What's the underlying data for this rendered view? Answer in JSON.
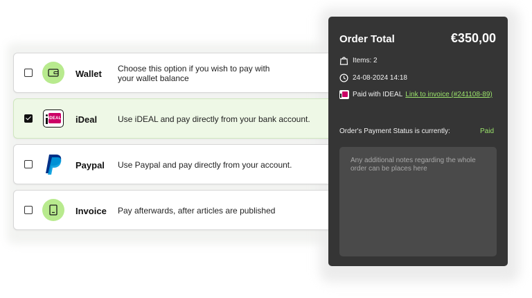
{
  "payment_methods": [
    {
      "name": "Wallet",
      "description": "Choose this option if you wish to pay with your wallet balance",
      "checked": false,
      "icon": "wallet-icon"
    },
    {
      "name": "iDeal",
      "description": "Use iDEAL and pay directly from your bank account.",
      "checked": true,
      "icon": "ideal-logo",
      "badge_text": "iDEAL"
    },
    {
      "name": "Paypal",
      "description": "Use Paypal and pay directly from your account.",
      "checked": false,
      "icon": "paypal-logo"
    },
    {
      "name": "Invoice",
      "description": "Pay afterwards, after articles are published",
      "checked": false,
      "icon": "invoice-icon"
    }
  ],
  "order": {
    "title": "Order Total",
    "amount": "€350,00",
    "items": "Items: 2",
    "datetime": "24-08-2024 14:18",
    "paid_with": "Paid with IDEAL",
    "invoice_link": "Link to invoice (#241108-89)",
    "status_label": "Order's Payment Status is currently:",
    "status_value": "Paid",
    "notes_placeholder": "Any additional notes regarding the whole order can be places here"
  },
  "colors": {
    "accent_green": "#9be36b",
    "selected_bg": "#eef8e6",
    "icon_green": "#b8ea8e",
    "panel_bg": "#353535",
    "ideal_pink": "#cc0066",
    "paypal_dark": "#003087",
    "paypal_light": "#009cde"
  }
}
